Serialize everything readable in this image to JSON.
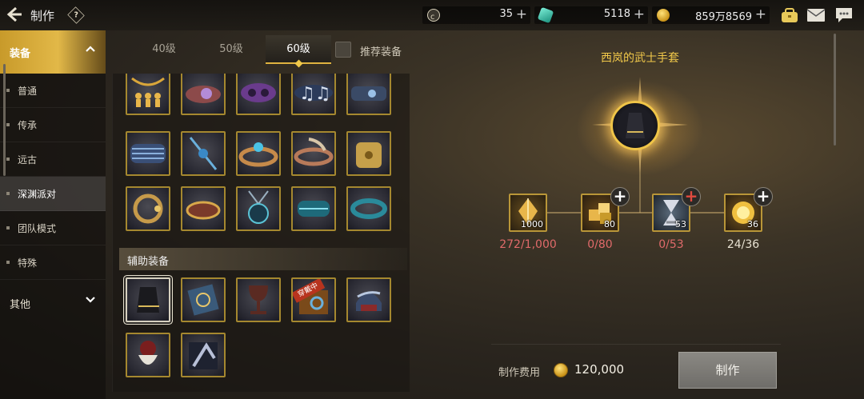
{
  "header": {
    "title": "制作",
    "help_label": "?",
    "currencies": [
      {
        "name": "c-token",
        "value": "35",
        "color": "#d7cfb8"
      },
      {
        "name": "gem",
        "value": "5118",
        "color": "#35c3a8"
      },
      {
        "name": "gold",
        "value": "859万8569",
        "color": "#e8b63a"
      }
    ]
  },
  "nav": {
    "categories": [
      {
        "label": "装备",
        "expanded": true
      },
      {
        "label": "其他",
        "expanded": false
      }
    ],
    "items": [
      {
        "label": "普通"
      },
      {
        "label": "传承"
      },
      {
        "label": "远古"
      },
      {
        "label": "深渊派对",
        "selected": true
      },
      {
        "label": "团队模式"
      },
      {
        "label": "特殊"
      }
    ]
  },
  "tabs": [
    {
      "label": "40级"
    },
    {
      "label": "50级"
    },
    {
      "label": "60级",
      "active": true
    }
  ],
  "recommend_label": "推荐装备",
  "section_label": "辅助装备",
  "selected_item_name": "西岚的武士手套",
  "materials": [
    {
      "count": "1000",
      "progress": "272/1,000",
      "status": "short",
      "plus": ""
    },
    {
      "count": "80",
      "progress": "0/80",
      "status": "short",
      "plus": "white"
    },
    {
      "count": "53",
      "progress": "0/53",
      "status": "short",
      "plus": "red"
    },
    {
      "count": "36",
      "progress": "24/36",
      "status": "ok",
      "plus": "white"
    }
  ],
  "cost": {
    "label": "制作费用",
    "value": "120,000"
  },
  "make_button": "制作",
  "item_badge": "穿戴中"
}
